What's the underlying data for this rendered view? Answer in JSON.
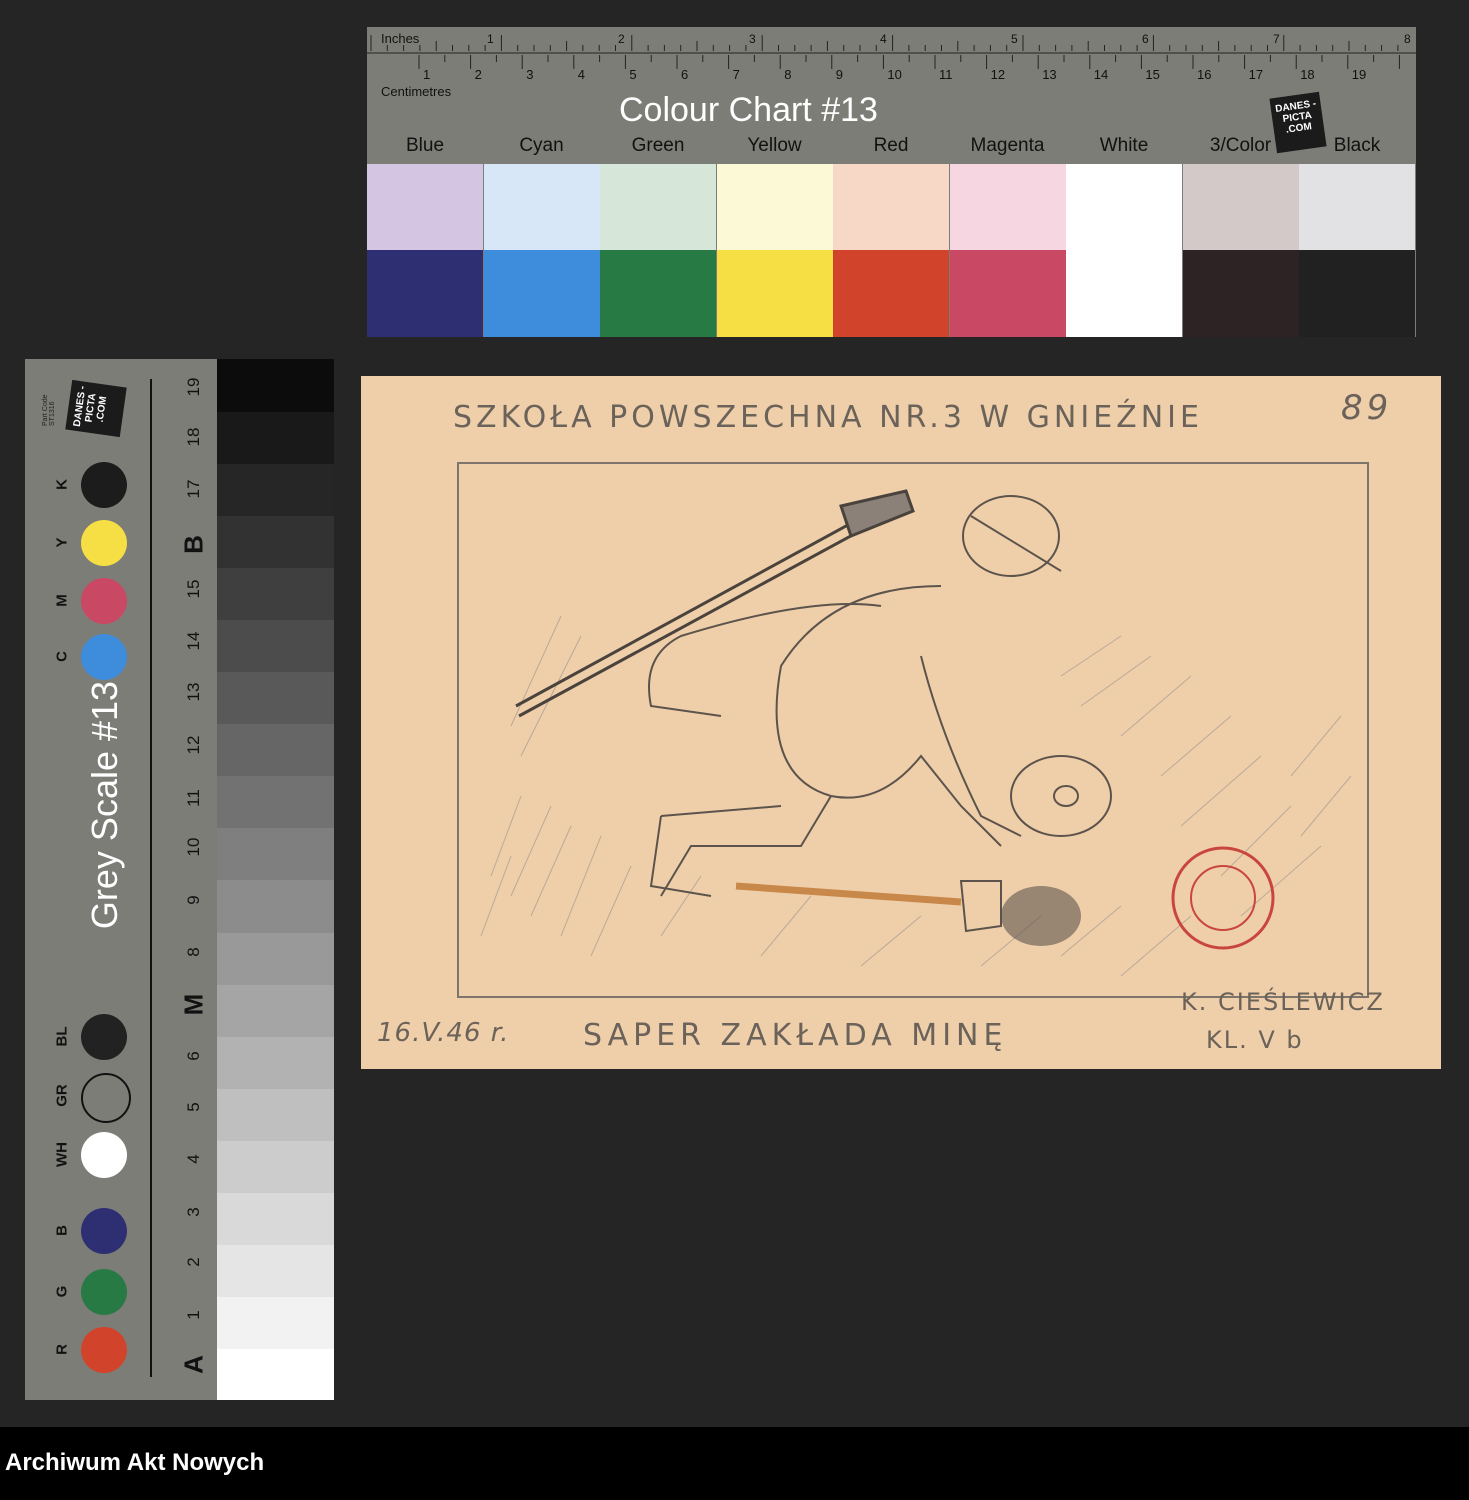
{
  "colour_chart": {
    "title": "Colour Chart #13",
    "inches_label": "Inches",
    "cm_label": "Centimetres",
    "inch_numbers": [
      "1",
      "2",
      "3",
      "4",
      "5",
      "6",
      "7",
      "8"
    ],
    "cm_numbers": [
      "1",
      "2",
      "3",
      "4",
      "5",
      "6",
      "7",
      "8",
      "9",
      "10",
      "11",
      "12",
      "13",
      "14",
      "15",
      "16",
      "17",
      "18",
      "19"
    ],
    "logo": "DANES -PICTA .COM",
    "swatches": [
      {
        "name": "Blue",
        "light": "#d4c6e3",
        "dark": "#2e2e73"
      },
      {
        "name": "Cyan",
        "light": "#d8e7f8",
        "dark": "#3e8ddc"
      },
      {
        "name": "Green",
        "light": "#d6e6d8",
        "dark": "#277a44"
      },
      {
        "name": "Yellow",
        "light": "#fbf9d6",
        "dark": "#f6de45"
      },
      {
        "name": "Red",
        "light": "#f7d7c6",
        "dark": "#d2432c"
      },
      {
        "name": "Magenta",
        "light": "#f6d7e1",
        "dark": "#c94863"
      },
      {
        "name": "White",
        "light": "#ffffff",
        "dark": "#ffffff"
      },
      {
        "name": "3/Color",
        "light": "#d2c9c8",
        "dark": "#2d2325"
      },
      {
        "name": "Black",
        "light": "#e2e2e4",
        "dark": "#212121"
      }
    ]
  },
  "grey_scale": {
    "title": "Grey Scale #13",
    "part_code": "Part Code ST1316",
    "logo": "DANES -PICTA .COM",
    "dot_labels": [
      "R",
      "G",
      "B",
      "WH",
      "GR",
      "BL",
      "C",
      "M",
      "Y",
      "K"
    ],
    "dot_colors": [
      "#d2432c",
      "#277a44",
      "#2e2e73",
      "#ffffff",
      "#7d7d77",
      "#222222",
      "#3e8ddc",
      "#c94863",
      "#f6de45",
      "#1c1c1c"
    ],
    "numbers": [
      "1",
      "2",
      "3",
      "4",
      "5",
      "6",
      "8",
      "9",
      "10",
      "11",
      "12",
      "13",
      "14",
      "15",
      "17",
      "18",
      "19"
    ],
    "letters": [
      "A",
      "M",
      "B"
    ]
  },
  "drawing": {
    "school": "SZKOŁA POWSZECHNA NR.3 W GNIEŹNIE",
    "page_number": "89",
    "date": "16.V.46 r.",
    "caption": "SAPER ZAKŁADA MINĘ",
    "author": "K. CIEŚLEWICZ",
    "class": "KL. V b"
  },
  "footer": {
    "text": "Archiwum Akt Nowych"
  }
}
